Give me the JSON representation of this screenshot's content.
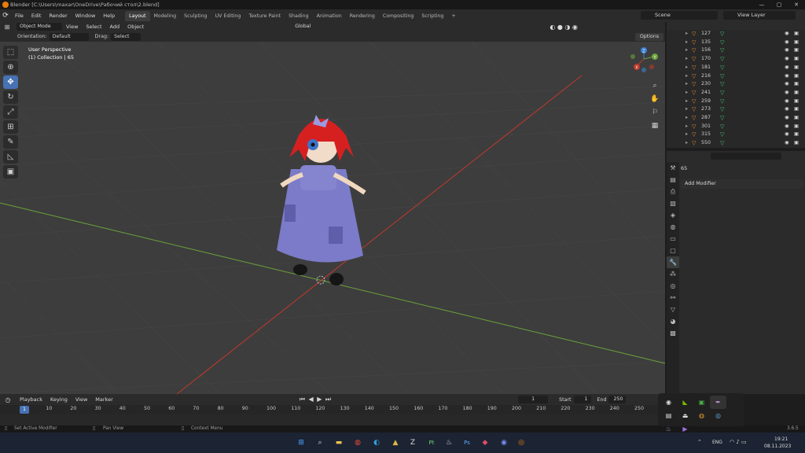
{
  "window": {
    "title": "Blender [C:\\Users\\maxar\\OneDrive\\Рабочий стол\\2.blend]",
    "controls": [
      "—",
      "▢",
      "✕"
    ]
  },
  "menu": {
    "items": [
      "File",
      "Edit",
      "Render",
      "Window",
      "Help"
    ]
  },
  "workspaces": {
    "tabs": [
      "Layout",
      "Modeling",
      "Sculpting",
      "UV Editing",
      "Texture Paint",
      "Shading",
      "Animation",
      "Rendering",
      "Compositing",
      "Scripting"
    ],
    "active": "Layout",
    "add": "+"
  },
  "scene": {
    "name": "Scene"
  },
  "view_layer": {
    "name": "View Layer"
  },
  "viewport_header": {
    "mode": "Object Mode",
    "menus": [
      "View",
      "Select",
      "Add",
      "Object"
    ],
    "transform_orientation": "Global"
  },
  "tool_settings": {
    "orientation_label": "Orientation:",
    "orientation_value": "Default",
    "drag_label": "Drag:",
    "drag_value": "Select Box",
    "options": "Options"
  },
  "viewport": {
    "label": "User Perspective",
    "collection": "(1) Collection | 65",
    "gizmo": {
      "z": "Z",
      "y": "Y",
      "x": "X"
    }
  },
  "outliner": {
    "rows": [
      "127",
      "135",
      "156",
      "170",
      "181",
      "216",
      "230",
      "241",
      "259",
      "273",
      "287",
      "301",
      "315",
      "550"
    ]
  },
  "properties": {
    "object_name": "65",
    "add_modifier": "Add Modifier"
  },
  "timeline": {
    "menus": [
      "Playback",
      "Keying",
      "View",
      "Marker"
    ],
    "current_frame": "1",
    "start_label": "Start",
    "start": "1",
    "end_label": "End",
    "end": "250",
    "ticks": [
      "1",
      "10",
      "20",
      "30",
      "40",
      "50",
      "60",
      "70",
      "80",
      "90",
      "100",
      "110",
      "120",
      "130",
      "140",
      "150",
      "160",
      "170",
      "180",
      "190",
      "200",
      "210",
      "220",
      "230",
      "240",
      "250"
    ]
  },
  "statusbar": {
    "left": "Set Active Modifier",
    "middle": "Pan View",
    "right": "Context Menu",
    "version": "3.6.5"
  },
  "taskbar": {
    "lang": "ENG",
    "time": "19:21",
    "date": "08.11.2023"
  },
  "colors": {
    "accent": "#4772b3",
    "x_axis": "#c0392b",
    "y_axis": "#6ba43a",
    "dress": "#7b7bc9",
    "hair": "#d62020"
  }
}
